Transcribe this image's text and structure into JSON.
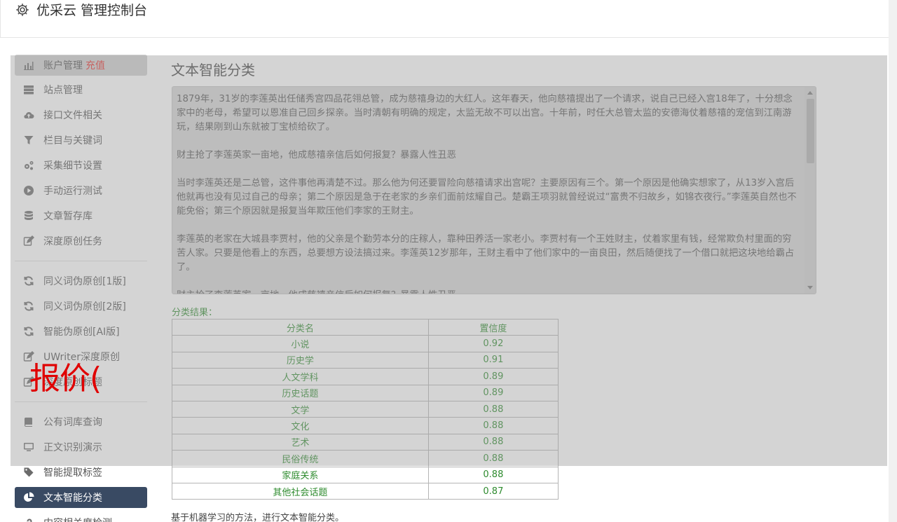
{
  "header": {
    "title": "优采云 管理控制台"
  },
  "sidebar": {
    "items": [
      {
        "label": "账户管理",
        "extra": "充值",
        "icon": "bar-chart-icon"
      },
      {
        "label": "站点管理",
        "icon": "server-icon"
      },
      {
        "label": "接口文件相关",
        "icon": "cloud-upload-icon"
      },
      {
        "label": "栏目与关键词",
        "icon": "filter-icon"
      },
      {
        "label": "采集细节设置",
        "icon": "cogs-icon"
      },
      {
        "label": "手动运行测试",
        "icon": "play-circle-icon"
      },
      {
        "label": "文章暂存库",
        "icon": "database-icon"
      },
      {
        "label": "深度原创任务",
        "icon": "edit-icon"
      },
      {
        "label": "同义词伪原创[1版]",
        "icon": "refresh-icon"
      },
      {
        "label": "同义词伪原创[2版]",
        "icon": "refresh-icon"
      },
      {
        "label": "智能伪原创[AI版]",
        "icon": "refresh-icon"
      },
      {
        "label": "UWriter深度原创",
        "icon": "edit-icon"
      },
      {
        "label": "深度原创标题",
        "icon": "edit-icon"
      },
      {
        "label": "公有词库查询",
        "icon": "book-icon"
      },
      {
        "label": "正文识别演示",
        "icon": "monitor-icon"
      },
      {
        "label": "智能提取标签",
        "icon": "tag-icon"
      },
      {
        "label": "文本智能分类",
        "icon": "pie-chart-icon"
      },
      {
        "label": "内容相关度检测",
        "icon": "link-icon"
      }
    ]
  },
  "main": {
    "title": "文本智能分类",
    "text_paragraphs": [
      "1879年，31岁的李莲英出任储秀宫四品花翎总管，成为慈禧身边的大红人。这年春天，他向慈禧提出了一个请求，说自己已经入宫18年了，十分想念家中的老母，希望可以恩准自己回乡探亲。当时清朝有明确的规定，太监无故不可以出宫。十年前，时任大总管太监的安德海仗着慈禧的宠信到江南游玩，结果刚到山东就被丁宝桢给砍了。",
      "财主抢了李莲英家一亩地，他成慈禧亲信后如何报复？暴露人性丑恶",
      "当时李莲英还是二总管，这件事他再清楚不过。那么他为何还要冒险向慈禧请求出宫呢？主要原因有三个。第一个原因是他确实想家了，从13岁入宫后他就再也没有见过自己的母亲；第二个原因是急于在老家的乡亲们面前炫耀自己。楚霸王项羽就曾经说过“富贵不归故乡，如锦衣夜行。”李莲英自然也不能免俗；第三个原因就是报复当年欺压他们李家的王财主。",
      "李莲英的老家在大城县李贾村，他的父亲是个勤劳本分的庄稼人，靠种田养活一家老小。李贾村有一个王姓财主，仗着家里有钱，经常欺负村里面的穷苦人家。只要是他看上的东西，总要想方设法搞过来。李莲英12岁那年，王财主看中了他们家中的一亩良田，然后随便找了一个借口就把这块地给霸占了。",
      "财主抢了李莲英家一亩地，他成慈禧亲信后如何报复？暴露人性丑恶"
    ],
    "result_label": "分类结果：",
    "table": {
      "headers": [
        "分类名",
        "置信度"
      ],
      "rows": [
        [
          "小说",
          "0.92"
        ],
        [
          "历史学",
          "0.91"
        ],
        [
          "人文学科",
          "0.89"
        ],
        [
          "历史话题",
          "0.89"
        ],
        [
          "文学",
          "0.88"
        ],
        [
          "文化",
          "0.88"
        ],
        [
          "艺术",
          "0.88"
        ],
        [
          "民俗传统",
          "0.88"
        ],
        [
          "家庭关系",
          "0.88"
        ],
        [
          "其他社会话题",
          "0.87"
        ]
      ]
    },
    "footer_note": "基于机器学习的方法，进行文本智能分类。"
  },
  "overlay_text": "报价(",
  "colors": {
    "active_nav": "#394a63",
    "recharge": "#e8322f",
    "result_green": "#2e8b2e",
    "overlay_red": "#e00000"
  }
}
